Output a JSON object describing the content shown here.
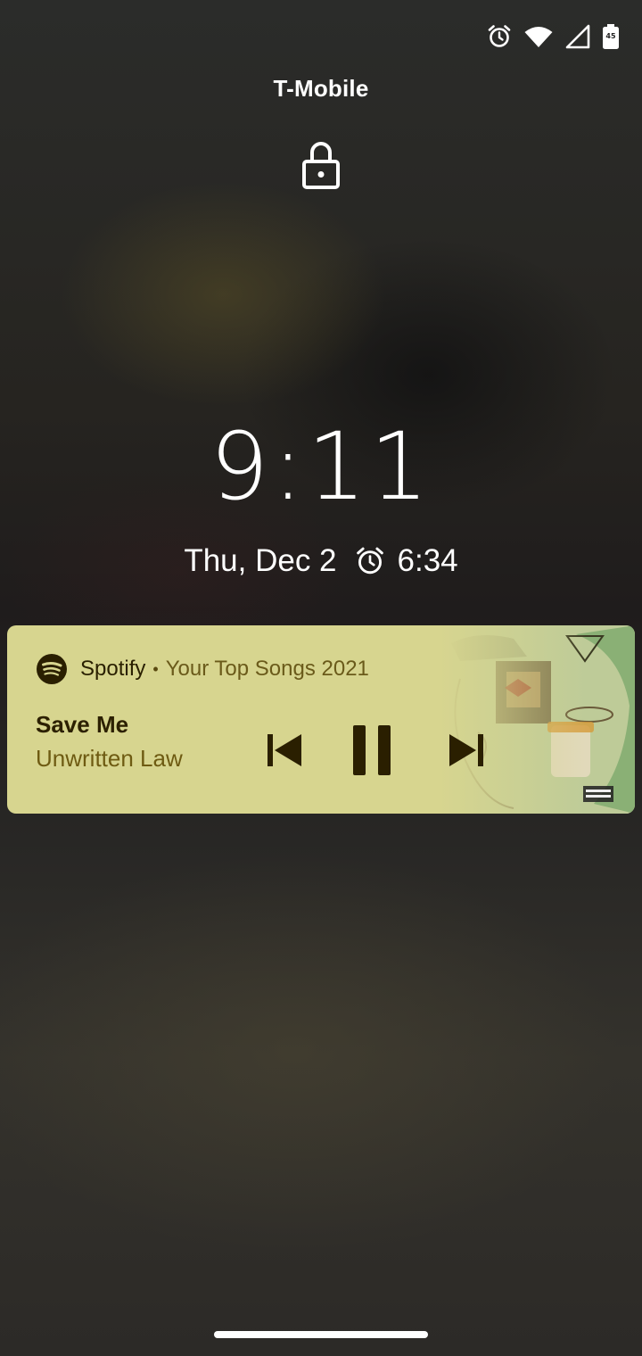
{
  "status_bar": {
    "icons": [
      "alarm-icon",
      "wifi-icon",
      "cell-signal-icon",
      "battery-icon"
    ],
    "battery_label": "45"
  },
  "lockscreen": {
    "carrier": "T-Mobile",
    "lock_icon": "lock-icon",
    "time": "9:11",
    "date": "Thu, Dec 2",
    "next_alarm": "6:34"
  },
  "media": {
    "app_name": "Spotify",
    "separator": "•",
    "context": "Your Top Songs 2021",
    "title": "Save Me",
    "artist": "Unwritten Law",
    "controls": [
      "previous-icon",
      "pause-icon",
      "next-icon"
    ],
    "colors": {
      "card": "#d7d58f",
      "title": "#2c2000",
      "artist": "#6e5b12",
      "icon": "#2a1f00"
    }
  }
}
